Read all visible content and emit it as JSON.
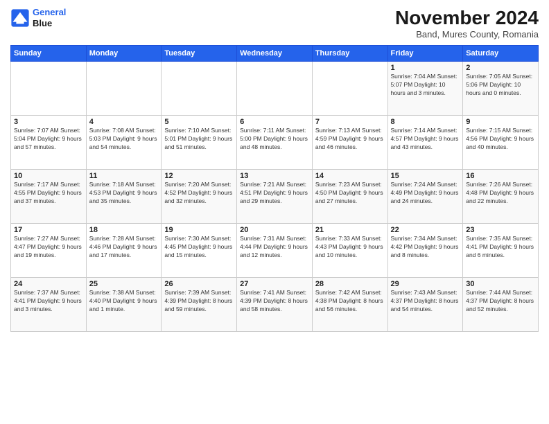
{
  "header": {
    "logo_line1": "General",
    "logo_line2": "Blue",
    "main_title": "November 2024",
    "subtitle": "Band, Mures County, Romania"
  },
  "calendar": {
    "days_of_week": [
      "Sunday",
      "Monday",
      "Tuesday",
      "Wednesday",
      "Thursday",
      "Friday",
      "Saturday"
    ],
    "weeks": [
      [
        {
          "day": "",
          "detail": ""
        },
        {
          "day": "",
          "detail": ""
        },
        {
          "day": "",
          "detail": ""
        },
        {
          "day": "",
          "detail": ""
        },
        {
          "day": "",
          "detail": ""
        },
        {
          "day": "1",
          "detail": "Sunrise: 7:04 AM\nSunset: 5:07 PM\nDaylight: 10 hours and 3 minutes."
        },
        {
          "day": "2",
          "detail": "Sunrise: 7:05 AM\nSunset: 5:06 PM\nDaylight: 10 hours and 0 minutes."
        }
      ],
      [
        {
          "day": "3",
          "detail": "Sunrise: 7:07 AM\nSunset: 5:04 PM\nDaylight: 9 hours and 57 minutes."
        },
        {
          "day": "4",
          "detail": "Sunrise: 7:08 AM\nSunset: 5:03 PM\nDaylight: 9 hours and 54 minutes."
        },
        {
          "day": "5",
          "detail": "Sunrise: 7:10 AM\nSunset: 5:01 PM\nDaylight: 9 hours and 51 minutes."
        },
        {
          "day": "6",
          "detail": "Sunrise: 7:11 AM\nSunset: 5:00 PM\nDaylight: 9 hours and 48 minutes."
        },
        {
          "day": "7",
          "detail": "Sunrise: 7:13 AM\nSunset: 4:59 PM\nDaylight: 9 hours and 46 minutes."
        },
        {
          "day": "8",
          "detail": "Sunrise: 7:14 AM\nSunset: 4:57 PM\nDaylight: 9 hours and 43 minutes."
        },
        {
          "day": "9",
          "detail": "Sunrise: 7:15 AM\nSunset: 4:56 PM\nDaylight: 9 hours and 40 minutes."
        }
      ],
      [
        {
          "day": "10",
          "detail": "Sunrise: 7:17 AM\nSunset: 4:55 PM\nDaylight: 9 hours and 37 minutes."
        },
        {
          "day": "11",
          "detail": "Sunrise: 7:18 AM\nSunset: 4:53 PM\nDaylight: 9 hours and 35 minutes."
        },
        {
          "day": "12",
          "detail": "Sunrise: 7:20 AM\nSunset: 4:52 PM\nDaylight: 9 hours and 32 minutes."
        },
        {
          "day": "13",
          "detail": "Sunrise: 7:21 AM\nSunset: 4:51 PM\nDaylight: 9 hours and 29 minutes."
        },
        {
          "day": "14",
          "detail": "Sunrise: 7:23 AM\nSunset: 4:50 PM\nDaylight: 9 hours and 27 minutes."
        },
        {
          "day": "15",
          "detail": "Sunrise: 7:24 AM\nSunset: 4:49 PM\nDaylight: 9 hours and 24 minutes."
        },
        {
          "day": "16",
          "detail": "Sunrise: 7:26 AM\nSunset: 4:48 PM\nDaylight: 9 hours and 22 minutes."
        }
      ],
      [
        {
          "day": "17",
          "detail": "Sunrise: 7:27 AM\nSunset: 4:47 PM\nDaylight: 9 hours and 19 minutes."
        },
        {
          "day": "18",
          "detail": "Sunrise: 7:28 AM\nSunset: 4:46 PM\nDaylight: 9 hours and 17 minutes."
        },
        {
          "day": "19",
          "detail": "Sunrise: 7:30 AM\nSunset: 4:45 PM\nDaylight: 9 hours and 15 minutes."
        },
        {
          "day": "20",
          "detail": "Sunrise: 7:31 AM\nSunset: 4:44 PM\nDaylight: 9 hours and 12 minutes."
        },
        {
          "day": "21",
          "detail": "Sunrise: 7:33 AM\nSunset: 4:43 PM\nDaylight: 9 hours and 10 minutes."
        },
        {
          "day": "22",
          "detail": "Sunrise: 7:34 AM\nSunset: 4:42 PM\nDaylight: 9 hours and 8 minutes."
        },
        {
          "day": "23",
          "detail": "Sunrise: 7:35 AM\nSunset: 4:41 PM\nDaylight: 9 hours and 6 minutes."
        }
      ],
      [
        {
          "day": "24",
          "detail": "Sunrise: 7:37 AM\nSunset: 4:41 PM\nDaylight: 9 hours and 3 minutes."
        },
        {
          "day": "25",
          "detail": "Sunrise: 7:38 AM\nSunset: 4:40 PM\nDaylight: 9 hours and 1 minute."
        },
        {
          "day": "26",
          "detail": "Sunrise: 7:39 AM\nSunset: 4:39 PM\nDaylight: 8 hours and 59 minutes."
        },
        {
          "day": "27",
          "detail": "Sunrise: 7:41 AM\nSunset: 4:39 PM\nDaylight: 8 hours and 58 minutes."
        },
        {
          "day": "28",
          "detail": "Sunrise: 7:42 AM\nSunset: 4:38 PM\nDaylight: 8 hours and 56 minutes."
        },
        {
          "day": "29",
          "detail": "Sunrise: 7:43 AM\nSunset: 4:37 PM\nDaylight: 8 hours and 54 minutes."
        },
        {
          "day": "30",
          "detail": "Sunrise: 7:44 AM\nSunset: 4:37 PM\nDaylight: 8 hours and 52 minutes."
        }
      ]
    ]
  }
}
